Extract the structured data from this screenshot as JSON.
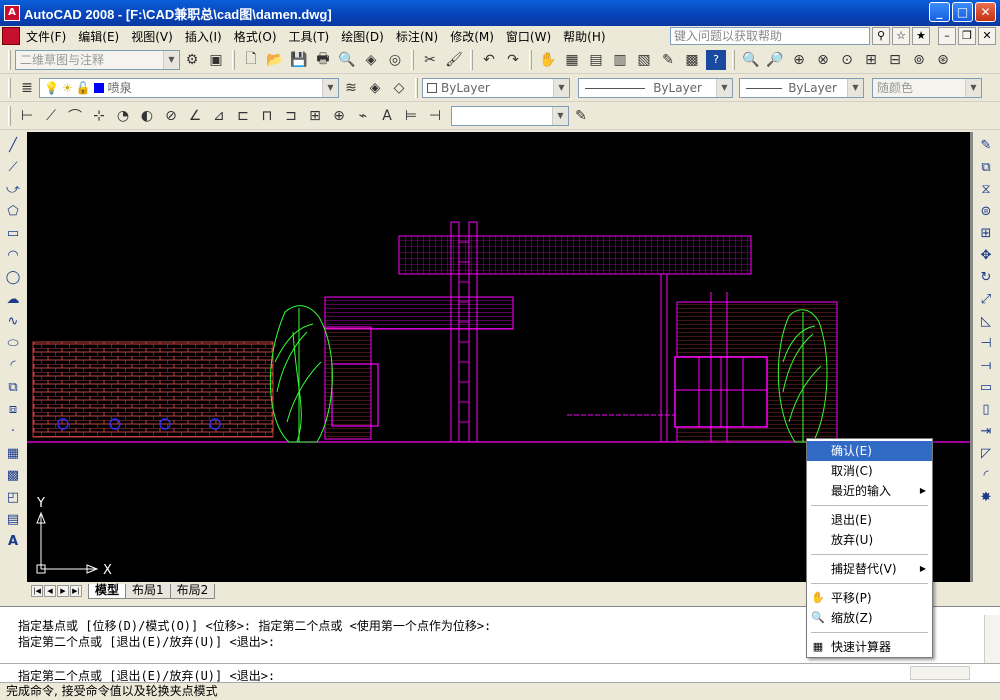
{
  "window": {
    "title": "AutoCAD 2008 - [F:\\CAD兼职总\\cad图\\damen.dwg]"
  },
  "menu": {
    "items": [
      "文件(F)",
      "编辑(E)",
      "视图(V)",
      "插入(I)",
      "格式(O)",
      "工具(T)",
      "绘图(D)",
      "标注(N)",
      "修改(M)",
      "窗口(W)",
      "帮助(H)"
    ],
    "help_placeholder": "键入问题以获取帮助"
  },
  "toolbar1": {
    "workspace": "二维草图与注释"
  },
  "toolbar2": {
    "layer": "喷泉",
    "color": "ByLayer",
    "linetype": "ByLayer",
    "lineweight": "ByLayer",
    "plotstyle": "随颜色"
  },
  "tabs": {
    "model": "模型",
    "layout1": "布局1",
    "layout2": "布局2"
  },
  "ucs": {
    "x_label": "X",
    "y_label": "Y"
  },
  "command": {
    "history": [
      "指定基点或 [位移(D)/模式(O)] <位移>: 指定第二个点或 <使用第一个点作为位移>:",
      "指定第二个点或 [退出(E)/放弃(U)] <退出>:"
    ],
    "current": "指定第二个点或 [退出(E)/放弃(U)] <退出>:"
  },
  "status_text": "完成命令, 接受命令值以及轮换夹点模式",
  "context_menu": {
    "confirm": "确认(E)",
    "cancel": "取消(C)",
    "recent_input": "最近的输入",
    "exit": "退出(E)",
    "undo": "放弃(U)",
    "snap_override": "捕捉替代(V)",
    "pan": "平移(P)",
    "zoom": "缩放(Z)",
    "quick_calc": "快速计算器"
  },
  "colors": {
    "title_blue": "#0742b8",
    "menu_highlight": "#316ac5",
    "drawing_magenta": "#ff00ff",
    "tree_green": "#33ff33",
    "brick_red": "#c04040"
  }
}
